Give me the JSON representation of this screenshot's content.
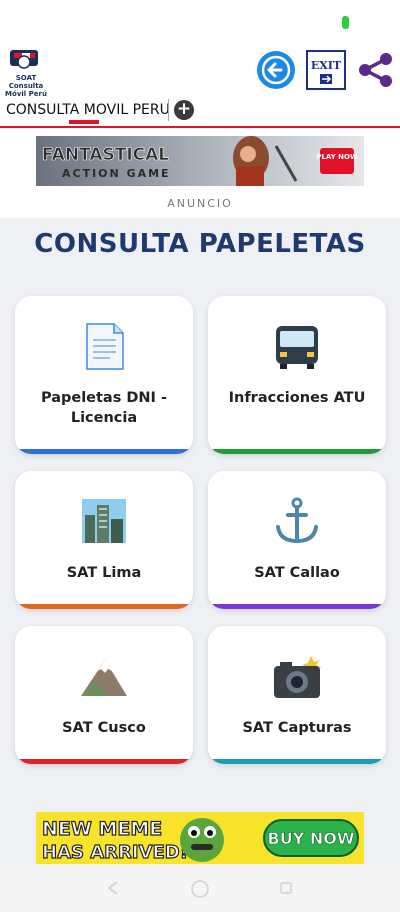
{
  "app": {
    "logo_lines": [
      "SOAT",
      "Consulta",
      "Móvil Perú"
    ],
    "exit_label": "EXIT",
    "tab_title": "CONSULTA MOVIL PERU",
    "tab_add": "+"
  },
  "ad_top": {
    "line1": "FANTASTICAL",
    "line2": "ACTION GAME",
    "cta": "PLAY NOW",
    "label": "ANUNCIO"
  },
  "page_title": "CONSULTA PAPELETAS",
  "cards": [
    {
      "label": "Papeletas DNI - Licencia",
      "icon": "document-icon",
      "bar_color": "#2f6fe0"
    },
    {
      "label": "Infracciones ATU",
      "icon": "bus-icon",
      "bar_color": "#1f9c3a"
    },
    {
      "label": "SAT Lima",
      "icon": "city-icon",
      "bar_color": "#e0671c"
    },
    {
      "label": "SAT Callao",
      "icon": "anchor-icon",
      "bar_color": "#7b35d8"
    },
    {
      "label": "SAT Cusco",
      "icon": "mountain-icon",
      "bar_color": "#e02424"
    },
    {
      "label": "SAT Capturas",
      "icon": "camera-icon",
      "bar_color": "#1a9bb8"
    }
  ],
  "ad_bottom": {
    "line1": "NEW MEME",
    "line2": "HAS ARRIVED!",
    "cta": "BUY NOW"
  },
  "colors": {
    "accent_red": "#e3122b",
    "title_blue": "#1e3a6e",
    "back_button_blue": "#1e88e5"
  }
}
